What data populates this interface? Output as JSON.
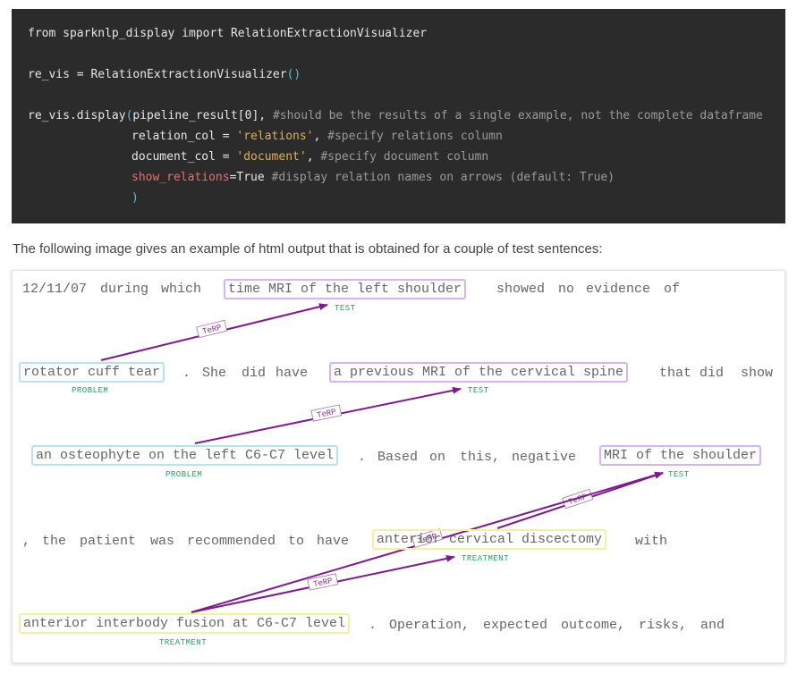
{
  "code": {
    "line1": "from sparknlp_display import RelationExtractionVisualizer",
    "line2_a": "re_vis = RelationExtractionVisualizer",
    "line2_b": "()",
    "line3_a": "re_vis.display",
    "line3_b": "(",
    "line3_c": "pipeline_result[0], ",
    "line3_d": "#should be the results of a single example, not the complete dataframe",
    "line4_a": "relation_col = ",
    "line4_b": "'relations'",
    "line4_c": ", ",
    "line4_d": "#specify relations column",
    "line5_a": "document_col = ",
    "line5_b": "'document'",
    "line5_c": ", ",
    "line5_d": "#specify document column",
    "line6_a": "show_relations",
    "line6_b": "=True ",
    "line6_c": "#display relation names on arrows (default: True)",
    "line7": ")"
  },
  "description": "The following image gives an example of html output that is obtained for a couple of test sentences:",
  "visualization": {
    "row1": {
      "w1": "12/11/07",
      "w2": "during",
      "w3": "which",
      "e1": "time MRI of the left shoulder",
      "w4": "showed",
      "w5": "no",
      "w6": "evidence",
      "w7": "of"
    },
    "row2": {
      "e1": "rotator cuff tear",
      "w1": ".",
      "w2": "She",
      "w3": "did",
      "w4": "have",
      "e2": "a previous MRI of the cervical spine",
      "w5": "that",
      "w6": "did",
      "w7": "show"
    },
    "row3": {
      "e1": "an osteophyte on the left C6-C7 level",
      "w1": ".",
      "w2": "Based",
      "w3": "on",
      "w4": "this,",
      "w5": "negative",
      "e2": "MRI of the shoulder"
    },
    "row4": {
      "w1": ",",
      "w2": "the",
      "w3": "patient",
      "w4": "was",
      "w5": "recommended",
      "w6": "to",
      "w7": "have",
      "e1": "anterior cervical discectomy",
      "w8": "with"
    },
    "row5": {
      "e1": "anterior interbody fusion at C6-C7 level",
      "w1": ".",
      "w2": "Operation,",
      "w3": "expected",
      "w4": "outcome,",
      "w5": "risks,",
      "w6": "and"
    },
    "tags": {
      "test": "TEST",
      "problem": "PROBLEM",
      "treatment": "TREATMENT"
    },
    "relation_label": "TeRP",
    "colors": {
      "arrow": "#7d1a8c",
      "test_border": "#d6b3f2",
      "problem_border": "#b9e1ee",
      "treatment_border": "#f1f1a3",
      "tag_text": "#22a35a"
    }
  }
}
